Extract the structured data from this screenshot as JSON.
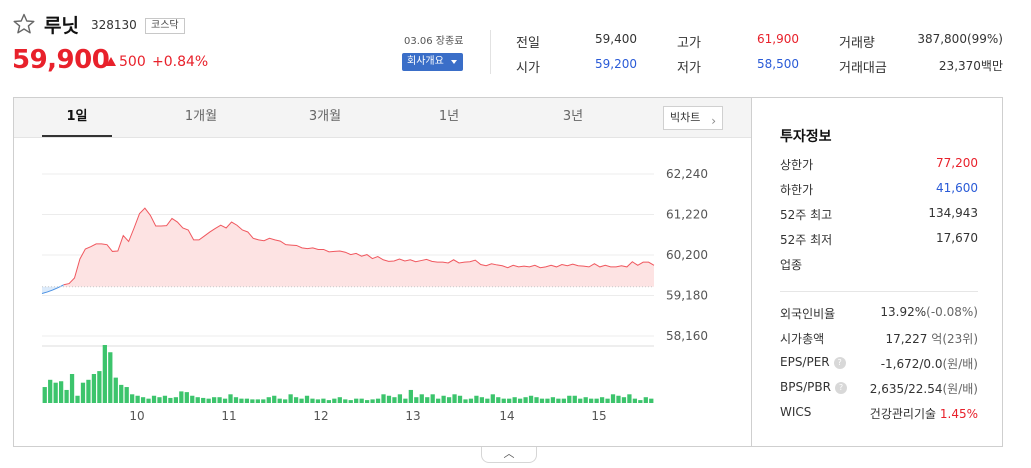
{
  "stock": {
    "name": "루닛",
    "code": "328130",
    "market": "코스닥",
    "price": "59,900",
    "change_amount": "500",
    "change_percent": "+0.84%",
    "up_color": "#e8212b",
    "down_color": "#2a5bd7"
  },
  "market_status": {
    "date": "03.06 장종료",
    "company_button": "회사개요"
  },
  "quotes": [
    {
      "label": "전일",
      "value": "59,400",
      "tone": "neutral"
    },
    {
      "label": "고가",
      "value": "61,900",
      "tone": "up"
    },
    {
      "label": "거래량",
      "value": "387,800(99%)",
      "tone": "neutral"
    },
    {
      "label": "시가",
      "value": "59,200",
      "tone": "down"
    },
    {
      "label": "저가",
      "value": "58,500",
      "tone": "down"
    },
    {
      "label": "거래대금",
      "value": "23,370백만",
      "tone": "neutral"
    }
  ],
  "tabs": [
    "1일",
    "1개월",
    "3개월",
    "1년",
    "3년"
  ],
  "big_chart_label": "빅차트",
  "icons": {
    "favorite": "star-outline-icon",
    "dropdown": "caret-down-icon",
    "next": "chevron-right-icon",
    "help": "help-circle-icon",
    "collapse": "chevron-up-icon"
  },
  "chart_data": {
    "type": "area",
    "y_tick_labels": [
      "62,240",
      "61,220",
      "60,200",
      "59,180",
      "58,160"
    ],
    "ylim": [
      58160,
      62240
    ],
    "x_tick_labels": [
      "10",
      "11",
      "12",
      "13",
      "14",
      "15"
    ],
    "reference_price": 59400,
    "price_series": [
      59230,
      59270,
      59320,
      59380,
      59450,
      59480,
      59620,
      60100,
      60350,
      60410,
      60480,
      60480,
      60460,
      60290,
      60300,
      60690,
      60540,
      60880,
      61240,
      61380,
      61200,
      60930,
      60930,
      60940,
      61120,
      61030,
      60880,
      60830,
      60580,
      60580,
      60680,
      60780,
      60870,
      60950,
      60880,
      61030,
      60950,
      60830,
      60780,
      60620,
      60580,
      60560,
      60620,
      60580,
      60550,
      60460,
      60450,
      60440,
      60380,
      60360,
      60380,
      60340,
      60340,
      60280,
      60290,
      60300,
      60270,
      60210,
      60240,
      60170,
      60210,
      60110,
      60160,
      60080,
      60040,
      60050,
      60100,
      60050,
      60080,
      60030,
      60060,
      60090,
      60040,
      60020,
      60020,
      60000,
      60080,
      60000,
      60020,
      60030,
      60070,
      59960,
      59930,
      59980,
      59950,
      59930,
      59880,
      59940,
      59900,
      59920,
      59900,
      59940,
      59880,
      59900,
      59940,
      59900,
      59960,
      59930,
      59970,
      59930,
      59920,
      59900,
      59980,
      59900,
      59940,
      59900,
      59900,
      59930,
      59900,
      60030,
      59940,
      60020,
      60020,
      59940
    ],
    "volume_series": [
      22,
      32,
      28,
      30,
      18,
      40,
      10,
      28,
      32,
      40,
      44,
      80,
      70,
      35,
      25,
      22,
      12,
      10,
      8,
      6,
      10,
      8,
      10,
      7,
      8,
      16,
      15,
      10,
      8,
      7,
      6,
      8,
      8,
      6,
      12,
      8,
      6,
      6,
      5,
      5,
      5,
      8,
      10,
      6,
      5,
      12,
      8,
      6,
      10,
      6,
      5,
      6,
      4,
      6,
      8,
      5,
      4,
      6,
      6,
      4,
      5,
      6,
      12,
      10,
      8,
      12,
      6,
      18,
      8,
      12,
      8,
      12,
      6,
      10,
      8,
      12,
      10,
      5,
      6,
      10,
      8,
      6,
      12,
      8,
      6,
      6,
      8,
      6,
      8,
      10,
      8,
      6,
      6,
      8,
      6,
      6,
      10,
      10,
      6,
      8,
      6,
      6,
      8,
      6,
      12,
      10,
      8,
      12,
      6,
      4,
      8,
      6
    ],
    "up_line_color": "#f0585f",
    "up_fill_color": "#fde3e3",
    "down_line_color": "#4a90e2",
    "down_fill_color": "#dcebfb",
    "volume_color": "#3cc46c"
  },
  "info": {
    "title": "투자정보",
    "rows": [
      {
        "label": "상한가",
        "value": "77,200",
        "tone": "up"
      },
      {
        "label": "하한가",
        "value": "41,600",
        "tone": "down"
      },
      {
        "label": "52주 최고",
        "value": "134,943",
        "tone": "neutral"
      },
      {
        "label": "52주 최저",
        "value": "17,670",
        "tone": "neutral"
      },
      {
        "label": "업종",
        "value": "",
        "tone": "neutral"
      }
    ],
    "rows2": [
      {
        "label": "외국인비율",
        "value": "13.92%",
        "sub": "(-0.08%)",
        "help": false
      },
      {
        "label": "시가총액",
        "value": "17,227",
        "sub": "억(23위)",
        "help": false
      },
      {
        "label": "EPS/PER",
        "value": "-1,672/0.0",
        "sub": "(원/배)",
        "help": true
      },
      {
        "label": "BPS/PBR",
        "value": "2,635/22.54",
        "sub": "(원/배)",
        "help": true
      },
      {
        "label": "WICS",
        "value": "건강관리기술",
        "sub": "1.45%",
        "help": false
      }
    ]
  }
}
